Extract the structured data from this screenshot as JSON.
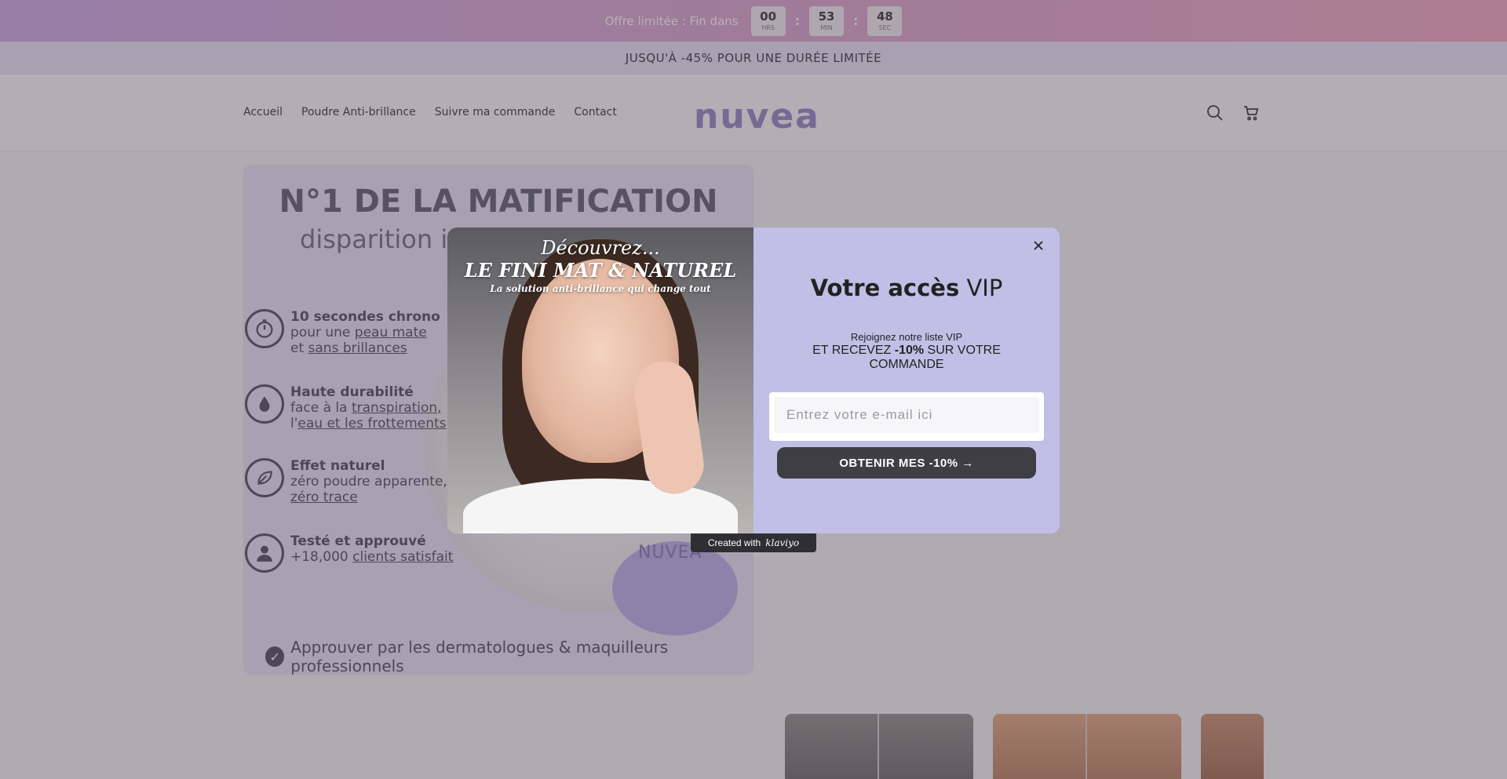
{
  "countdown": {
    "label": "Offre limitée : Fin dans",
    "hours": "00",
    "hours_unit": "HRS",
    "minutes": "53",
    "minutes_unit": "MIN",
    "seconds": "48",
    "seconds_unit": "SEC",
    "separator": ":"
  },
  "promo": {
    "text": "JUSQU'À -45% POUR UNE DURÉE LIMITÉE"
  },
  "nav": {
    "items": [
      {
        "label": "Accueil"
      },
      {
        "label": "Poudre Anti-brillance"
      },
      {
        "label": "Suivre ma commande"
      },
      {
        "label": "Contact"
      }
    ]
  },
  "logo": {
    "text": "nuvea"
  },
  "header_icons": [
    "search-icon",
    "cart-icon"
  ],
  "product_image": {
    "title": "N°1 DE LA MATIFICATION",
    "subtitle": "disparition ins",
    "features": [
      {
        "icon": "stopwatch-icon",
        "title": "10 secondes chrono",
        "line1_prefix": "pour une ",
        "line1_link": "peau mate",
        "line2_prefix": "et ",
        "line2_link": "sans brillances"
      },
      {
        "icon": "water-drop-icon",
        "title": "Haute durabilité",
        "line1_prefix": "face à la ",
        "line1_link": "transpiration,",
        "line2_prefix": "l'",
        "line2_link": "eau et les frottements"
      },
      {
        "icon": "leaf-icon",
        "title": "Effet naturel",
        "line1_prefix": "zéro poudre apparente,",
        "line1_link": "",
        "line2_prefix": "",
        "line2_link": "zéro trace"
      },
      {
        "icon": "person-icon",
        "title": "Testé et approuvé",
        "line1_prefix": "+18,000 ",
        "line1_link": "clients satisfait",
        "line2_prefix": "",
        "line2_link": ""
      }
    ],
    "puff_label": "NUVEA",
    "footer": "Approuver par les dermatologues & maquilleurs professionnels"
  },
  "modal": {
    "image_line1": "Découvrez...",
    "image_line2": "LE FINI MAT & NATUREL",
    "image_line3": "La solution anti-brillance qui change tout",
    "title_bold": "Votre accès",
    "title_light": " VIP",
    "lead": "Rejoignez notre liste VIP",
    "offer_prefix": "ET RECEVEZ ",
    "offer_bold": "-10%",
    "offer_suffix": " SUR VOTRE COMMANDE",
    "email_placeholder": "Entrez votre e-mail ici",
    "submit_label": "OBTENIR MES -10% →",
    "badge_prefix": "Created with",
    "badge_brand": "klaviyo"
  },
  "colors": {
    "accent": "#8e87c4",
    "modal_bg": "#c2bfe6",
    "button_dark": "#3e3e44"
  }
}
